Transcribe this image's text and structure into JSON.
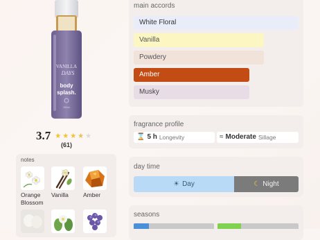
{
  "product": {
    "bottle_text": [
      "VANILLA",
      "DAYS",
      "body",
      "splash.",
      "250ml"
    ],
    "rating": "3.7",
    "stars": {
      "value": 3.7,
      "max": 5
    },
    "rating_count": "(61)"
  },
  "notes": {
    "title": "notes",
    "items": [
      {
        "label_line1": "Orange",
        "label_line2": "Blossom",
        "icon": "orange-blossom-icon"
      },
      {
        "label_line1": "Vanilla",
        "label_line2": "",
        "icon": "vanilla-icon"
      },
      {
        "label_line1": "Amber",
        "label_line2": "",
        "icon": "amber-icon"
      },
      {
        "label_line1": "",
        "label_line2": "",
        "icon": "white-note-icon"
      },
      {
        "label_line1": "",
        "label_line2": "",
        "icon": "green-flowers-icon"
      },
      {
        "label_line1": "",
        "label_line2": "",
        "icon": "purple-flowers-icon"
      }
    ]
  },
  "accords": {
    "title": "main accords",
    "items": [
      {
        "label": "White Floral",
        "strength": 1.0,
        "color": "#e8edf9",
        "text_color": "#333333"
      },
      {
        "label": "Vanilla",
        "strength": 0.79,
        "color": "#fbf6c2",
        "text_color": "#555555"
      },
      {
        "label": "Powdery",
        "strength": 0.79,
        "color": "#f1e3da",
        "text_color": "#555555"
      },
      {
        "label": "Amber",
        "strength": 0.69,
        "color": "#c24c14",
        "text_color": "#ffffff"
      },
      {
        "label": "Musky",
        "strength": 0.69,
        "color": "#e8dde7",
        "text_color": "#444444"
      }
    ]
  },
  "profile": {
    "title": "fragrance profile",
    "longevity_value": "5 h",
    "longevity_label": "Longevity",
    "longevity_icon": "hourglass-icon",
    "sillage_value": "Moderate",
    "sillage_label": "Sillage",
    "sillage_icon": "waves-icon"
  },
  "daytime": {
    "title": "day time",
    "day_label": "Day",
    "night_label": "Night",
    "day_icon": "sun-icon",
    "night_icon": "moon-icon",
    "day_fraction": 0.61,
    "day_color": "#b9daf6",
    "night_color": "#7b7b7b"
  },
  "seasons": {
    "title": "seasons",
    "bars": [
      {
        "fill": 0.09,
        "color": "#4a90d9"
      },
      {
        "fill": 0.29,
        "color": "#7fd14f"
      }
    ]
  }
}
